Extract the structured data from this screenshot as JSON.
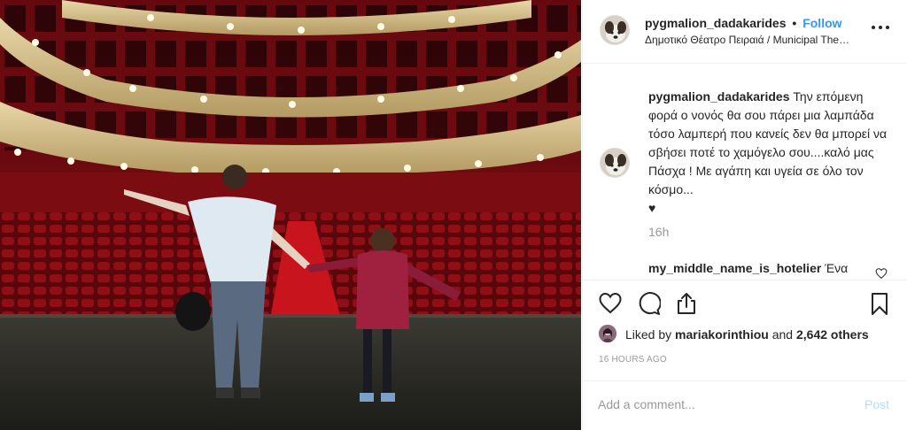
{
  "post": {
    "username": "pygmalion_dadakarides",
    "separator": "•",
    "follow_label": "Follow",
    "location": "Δημοτικό Θέατρο Πειραιά / Municipal Theatre of Piraeus",
    "more_icon": "more-horizontal-icon"
  },
  "caption": {
    "username": "pygmalion_dadakarides",
    "text": "Την επόμενη φορά ο νονός θα σου πάρει μια λαμπάδα τόσο λαμπερή που κανείς δεν θα μπορεί να σβήσει ποτέ το χαμόγελο σου....καλό μας Πάσχα ! Με αγάπη και υγεία σε όλο τον κόσμο...",
    "emoji": "♥",
    "time_ago": "16h"
  },
  "comment": {
    "username": "my_middle_name_is_hotelier",
    "text": "Ένα"
  },
  "actions": {
    "like_icon": "heart-icon",
    "comment_icon": "comment-icon",
    "share_icon": "share-icon",
    "save_icon": "bookmark-icon"
  },
  "likes": {
    "prefix": "Liked by ",
    "user": "mariakorinthiou",
    "middle": " and ",
    "others": "2,642 others"
  },
  "timestamp": "16 HOURS AGO",
  "add_comment": {
    "placeholder": "Add a comment...",
    "post_label": "Post"
  },
  "colors": {
    "accent": "#3897f0",
    "post_disabled": "#b2dffc",
    "theatre_red": "#8e1016"
  }
}
